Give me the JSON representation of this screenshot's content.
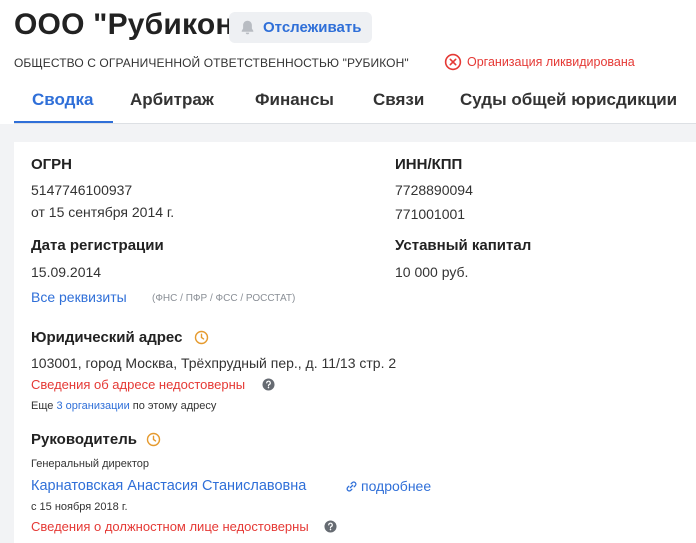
{
  "header": {
    "title": "ООО \"Рубикон\"",
    "follow_label": "Отслеживать",
    "full_name": "ОБЩЕСТВО С ОГРАНИЧЕННОЙ ОТВЕТСТВЕННОСТЬЮ \"РУБИКОН\"",
    "status": "Организация ликвидирована"
  },
  "tabs": [
    {
      "label": "Сводка",
      "active": true
    },
    {
      "label": "Арбитраж"
    },
    {
      "label": "Финансы"
    },
    {
      "label": "Связи"
    },
    {
      "label": "Суды общей юрисдикции"
    }
  ],
  "summary": {
    "ogrn": {
      "label": "ОГРН",
      "value": "5147746100937",
      "date": "от 15 сентября 2014 г."
    },
    "inn_kpp": {
      "label": "ИНН/КПП",
      "inn": "7728890094",
      "kpp": "771001001"
    },
    "reg_date": {
      "label": "Дата регистрации",
      "value": "15.09.2014"
    },
    "capital": {
      "label": "Уставный капитал",
      "value": "10 000 руб."
    },
    "all_details": {
      "link": "Все реквизиты",
      "note": "(ФНС / ПФР / ФСС / РОССТАТ)"
    },
    "address": {
      "label": "Юридический адрес",
      "value": "103001, город Москва, Трёхпрудный пер., д. 11/13 стр. 2",
      "warning": "Сведения об адресе недостоверны",
      "more_prefix": "Еще",
      "more_link": "3 организации",
      "more_suffix": "по этому адресу"
    },
    "head": {
      "label": "Руководитель",
      "position": "Генеральный директор",
      "name": "Карнатовская Анастасия Станиславовна",
      "more": "подробнее",
      "since": "с 15 ноября 2018 г.",
      "warning": "Сведения о должностном лице недостоверны"
    }
  },
  "colors": {
    "accent": "#2f6fd8",
    "danger": "#e53935",
    "clock": "#e59a2e"
  }
}
